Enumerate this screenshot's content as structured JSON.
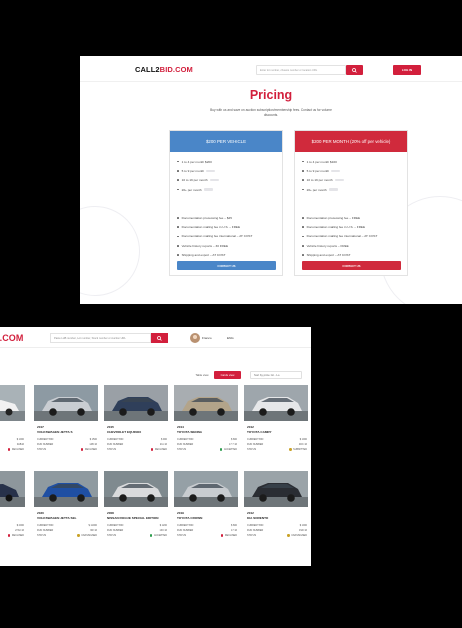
{
  "pricing_page": {
    "logo": {
      "part1": "CALL2",
      "part2": "BID.COM"
    },
    "search_placeholder": "Enter lot number, chassis number or location URL",
    "login_label": "LOG IN",
    "title": "Pricing",
    "subtitle": "Buy with us and save on auction subscription/membership fees. Contact us for volume discounts.",
    "plans": [
      {
        "header": "$200 PER VEHICLE",
        "tiers": [
          "1 to 4 per month $200",
          "5 to 9 per month",
          "10 to 19 per month",
          "20+ per month"
        ],
        "extras": [
          "Documentation processing fee – $45",
          "Documentation mailing fee in U.S. – FREE",
          "Documentation mailing fee international – AT COST",
          "Vehicle history reports – 30 FREE",
          "Shipping and export – AT COST"
        ],
        "contact_label": "CONTACT US",
        "color": "#4a86c8"
      },
      {
        "header": "$200 PER MONTH (20% off per vehicle)",
        "tiers": [
          "1 to 4 per month $160",
          "5 to 9 per month",
          "10 to 19 per month",
          "20+ per month"
        ],
        "extras": [
          "Documentation processing fee – FREE",
          "Documentation mailing fee in U.S. – FREE",
          "Documentation mailing fee international – AT COST",
          "Vehicle history reports – FREE",
          "Shipping and export – AT COST"
        ],
        "contact_label": "CONTACT US",
        "color": "#d02a3c"
      }
    ]
  },
  "listing_page": {
    "logo": {
      "part2": "D.COM"
    },
    "search_placeholder": "Paste LHB number, Lot number, Stock number or Auction URL",
    "user_name": "Franco",
    "language": "ENG",
    "view_table_label": "Table view",
    "view_cards_label": "Cards view",
    "sort_label": "Sort by price: Hi - Lo",
    "partial_left": {
      "prices": [
        "$ 1000",
        "$ 2000"
      ],
      "mid": [
        "0AB16",
        "27A0 16"
      ],
      "status": [
        "DECLINED",
        "DECLINED"
      ]
    },
    "cards": [
      {
        "year": "2017",
        "model": "VOLKSWAGEN JETTA S",
        "price": "$ 1500",
        "run": "14B 16",
        "status": "DECLINED",
        "status_color": "#d21f3c",
        "body": "#c9cdd2",
        "bg": "#8d9aa3"
      },
      {
        "year": "2015",
        "model": "CHEVROLET EQUINOX",
        "price": "$ 900",
        "run": "211 16",
        "status": "DECLINED",
        "status_color": "#d21f3c",
        "body": "#2f3f5a",
        "bg": "#9aa0a6"
      },
      {
        "year": "2014",
        "model": "TOYOTA SIENNA",
        "price": "$ 800",
        "run": "17 7 16",
        "status": "ACCEPTED",
        "status_color": "#2e9e4f",
        "body": "#b3a48a",
        "bg": "#a8adb1"
      },
      {
        "year": "2012",
        "model": "TOYOTA CAMRY",
        "price": "$ 1000",
        "run": "4DC 16",
        "status": "SUBMITTED",
        "status_color": "#c9a227",
        "body": "#e6e7e9",
        "bg": "#9ea6ac"
      },
      {
        "year": "2020",
        "model": "VOLKSWAGEN JETTA SEL",
        "price": "$ 11000",
        "run": "3W 16",
        "status": "UNASSIGNED",
        "status_color": "#c9a227",
        "body": "#1f4fa3",
        "bg": "#8f9aa0"
      },
      {
        "year": "2008",
        "model": "NISSAN ROGUE SPECIAL EDITION",
        "price": "$ 1200",
        "run": "1F0 16",
        "status": "ACCEPTED",
        "status_color": "#2e9e4f",
        "body": "#d9dadc",
        "bg": "#7f8a8f"
      },
      {
        "year": "2019",
        "model": "TOYOTA CROWN",
        "price": "$ 800",
        "run": "17 16",
        "status": "DECLINED",
        "status_color": "#d21f3c",
        "body": "#c8ccd0",
        "bg": "#95a0a6"
      },
      {
        "year": "2012",
        "model": "KIA SORENTO",
        "price": "$ 1000",
        "run": "4SD 16",
        "status": "UNASSIGNED",
        "status_color": "#c9a227",
        "body": "#2a2d33",
        "bg": "#9aa3a8"
      }
    ],
    "labels": {
      "current_bid": "CURRENT BID",
      "run_number": "RUN NUMBER",
      "status": "STATUS"
    }
  }
}
